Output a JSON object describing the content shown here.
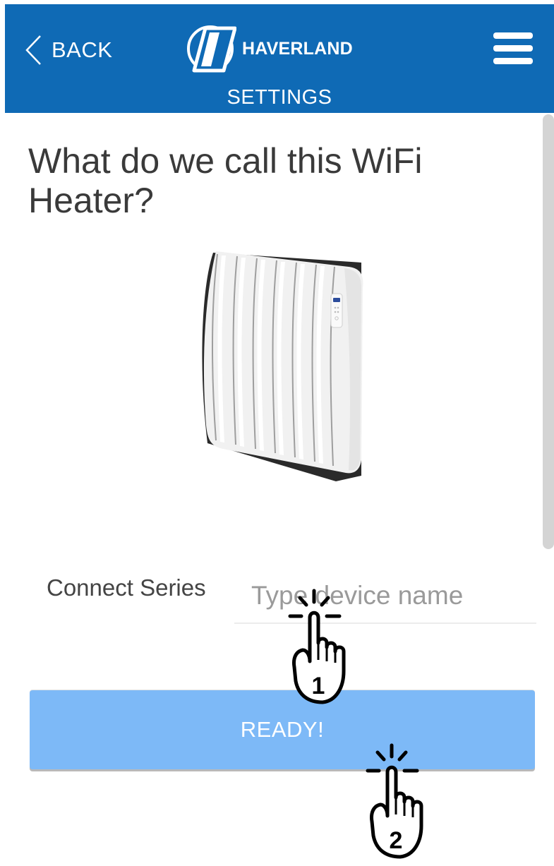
{
  "header": {
    "back_label": "BACK",
    "brand_name": "HAVERLAND",
    "page_title": "SETTINGS",
    "background_color": "#0f6ab5"
  },
  "main": {
    "question": "What do we call this WiFi Heater?",
    "product_image": "wifi-heater-image",
    "name_field": {
      "label": "Connect Series",
      "value": "",
      "placeholder": "Type device name"
    },
    "ready_button": {
      "label": "READY!",
      "color": "#7db9f7"
    }
  },
  "annotations": {
    "step_1": "1",
    "step_2": "2"
  }
}
